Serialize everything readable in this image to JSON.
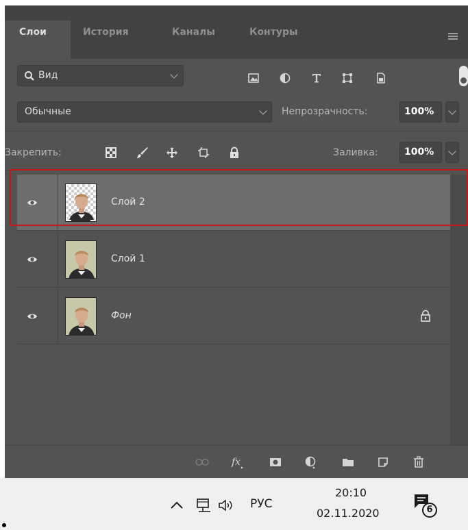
{
  "panel": {
    "tabs": [
      {
        "label": "Слои"
      },
      {
        "label": "История"
      },
      {
        "label": "Каналы"
      },
      {
        "label": "Контуры"
      }
    ],
    "filter": {
      "label": "Вид"
    },
    "blend_mode": "Обычные",
    "opacity": {
      "label": "Непрозрачность:",
      "value": "100%"
    },
    "lock": {
      "label": "Закрепить:"
    },
    "fill": {
      "label": "Заливка:",
      "value": "100%"
    },
    "layers": [
      {
        "name": "Слой 2",
        "selected": true,
        "italic": false,
        "locked": false
      },
      {
        "name": "Слой 1",
        "selected": false,
        "italic": false,
        "locked": false
      },
      {
        "name": "Фон",
        "selected": false,
        "italic": true,
        "locked": true
      }
    ]
  },
  "taskbar": {
    "language": "РУС",
    "time": "20:10",
    "date": "02.11.2020",
    "notification_count": "6"
  },
  "colors": {
    "panel_bg": "#535353",
    "tab_bar_bg": "#424242",
    "selected_row_bg": "#6d6d6d",
    "selection_highlight": "#c81717",
    "taskbar_bg": "#f0f0f0"
  }
}
